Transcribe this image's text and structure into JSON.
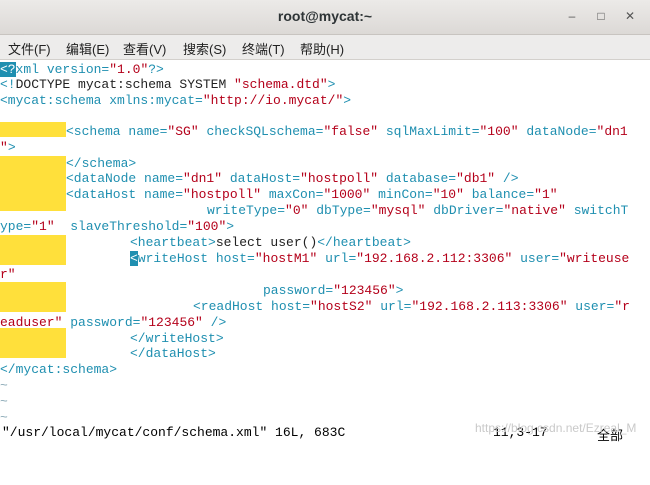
{
  "window": {
    "title": "root@mycat:~",
    "minimize": "–",
    "maximize": "□",
    "close": "✕"
  },
  "menu": {
    "file": "文件(F)",
    "edit": "编辑(E)",
    "view": "查看(V)",
    "search": "搜索(S)",
    "terminal": "终端(T)",
    "help": "帮助(H)"
  },
  "editor": {
    "l1": {
      "a": "<?",
      "b": "xml",
      "c": " version=",
      "d": "\"1.0\"",
      "e": "?>"
    },
    "l2": {
      "a": "<!",
      "b": "DOCTYPE mycat:schema SYSTEM ",
      "c": "\"schema.dtd\"",
      "d": ">"
    },
    "l3": {
      "a": "<mycat:",
      "b": "schema",
      "c": " xmlns:mycat=",
      "d": "\"http://io.mycat/\"",
      "e": ">"
    },
    "l4": {
      "a": "<schema",
      "b": " name=",
      "c": "\"SG\"",
      "d": " checkSQLschema=",
      "e": "\"false\"",
      "f": " sqlMaxLimit=",
      "g": "\"100\"",
      "h": " dataNode=",
      "i": "\"dn1"
    },
    "l5": {
      "a": "\"",
      "b": ">"
    },
    "l6": {
      "a": "</schema>"
    },
    "l7": {
      "a": "<dataNode",
      "b": " name=",
      "c": "\"dn1\"",
      "d": " dataHost=",
      "e": "\"hostpoll\"",
      "f": " database=",
      "g": "\"db1\"",
      "h": " />"
    },
    "l8": {
      "a": "<dataHost",
      "b": " name=",
      "c": "\"hostpoll\"",
      "d": " maxCon=",
      "e": "\"1000\"",
      "f": " minCon=",
      "g": "\"10\"",
      "h": " balance=",
      "i": "\"1\""
    },
    "l9": {
      "a": "writeType=",
      "b": "\"0\"",
      "c": " dbType=",
      "d": "\"mysql\"",
      "e": " dbDriver=",
      "f": "\"native\"",
      "g": " switchT"
    },
    "l10": {
      "a": "ype=",
      "b": "\"1\"",
      "c": "  slaveThreshold=",
      "d": "\"100\"",
      "e": ">"
    },
    "l11": {
      "a": "<heartbeat>",
      "b": "select user()",
      "c": "</heartbeat>"
    },
    "l12": {
      "cursor": "<",
      "a": "writeHost",
      "b": " host=",
      "c": "\"hostM1\"",
      "d": " url=",
      "e": "\"192.168.2.112:3306\"",
      "f": " user=",
      "g": "\"writeuse"
    },
    "l13": {
      "a": "r\""
    },
    "l14": {
      "a": "password=",
      "b": "\"123456\"",
      "c": ">"
    },
    "l15": {
      "a": "<readHost",
      "b": " host=",
      "c": "\"hostS2\"",
      "d": " url=",
      "e": "\"192.168.2.113:3306\"",
      "f": " user=",
      "g": "\"r"
    },
    "l16": {
      "a": "eaduser\"",
      "b": " password=",
      "c": "\"123456\"",
      "d": " />"
    },
    "l17": {
      "a": "</writeHost>"
    },
    "l18": {
      "a": "</dataHost>"
    },
    "l19": {
      "a": "</mycat:",
      "b": "schema",
      "c": ">"
    },
    "tilde": "~"
  },
  "status": {
    "file": "\"/usr/local/mycat/conf/schema.xml\" 16L, 683C",
    "position": "11,3-17",
    "scroll": "全部"
  },
  "watermark": "https://blog.csdn.net/Ezreal_M"
}
